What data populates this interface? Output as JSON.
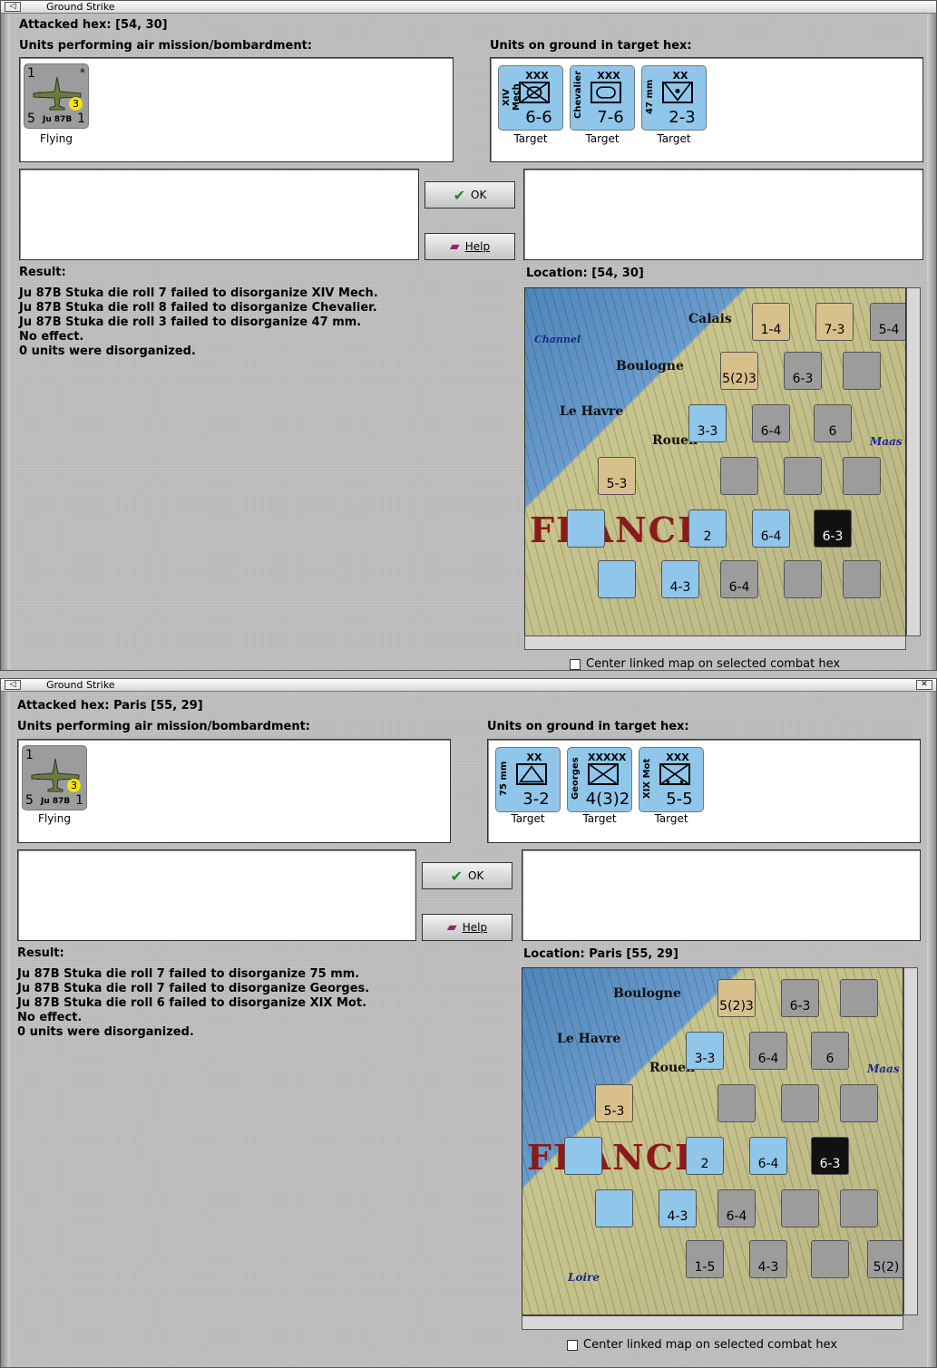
{
  "windows": [
    {
      "title": "Ground Strike",
      "attacked_hex": "Attacked hex:  [54, 30]",
      "air_units_label": "Units performing air mission/bombardment:",
      "ground_units_label": "Units on ground in target hex:",
      "air_unit": {
        "top_left": "1",
        "top_right": "*",
        "name": "Stuka",
        "model": "Ju 87B",
        "bottom_left": "5",
        "bottom_right": "1",
        "badge": "3",
        "status": "Flying"
      },
      "targets": [
        {
          "name": "XIV Mech",
          "size": "XXX",
          "strength": "6-6",
          "caption": "Target"
        },
        {
          "name": "Chevalier",
          "size": "XXX",
          "strength": "7-6",
          "caption": "Target"
        },
        {
          "name": "47 mm",
          "size": "XX",
          "strength": "2-3",
          "caption": "Target"
        }
      ],
      "ok_label": "OK",
      "help_label": "Help",
      "result_label": "Result:",
      "results": [
        "Ju 87B Stuka die roll 7 failed to disorganize XIV Mech.",
        "Ju 87B Stuka die roll 8 failed to disorganize Chevalier.",
        "Ju 87B Stuka die roll 3 failed to disorganize 47 mm.",
        "No effect.",
        "0 units were disorganized."
      ],
      "location": "Location:   [54, 30]",
      "center_label": "Center linked map on selected combat hex",
      "map_labels": [
        "Calais",
        "Boulogne",
        "Le Havre",
        "Rouen",
        "Channel",
        "Maas",
        "FRANCE"
      ]
    },
    {
      "title": "Ground Strike",
      "attacked_hex": "Attacked hex: Paris  [55, 29]",
      "air_units_label": "Units performing air mission/bombardment:",
      "ground_units_label": "Units on ground in target hex:",
      "air_unit": {
        "top_left": "1",
        "top_right": "",
        "name": "Stuka",
        "model": "Ju 87B",
        "bottom_left": "5",
        "bottom_right": "1",
        "badge": "3",
        "status": "Flying"
      },
      "targets": [
        {
          "name": "75 mm",
          "size": "XX",
          "strength": "3-2",
          "caption": "Target"
        },
        {
          "name": "Georges",
          "size": "XXXXX",
          "strength": "4(3)2",
          "caption": "Target"
        },
        {
          "name": "XIX Mot",
          "size": "XXX",
          "strength": "5-5",
          "caption": "Target"
        }
      ],
      "ok_label": "OK",
      "help_label": "Help",
      "result_label": "Result:",
      "results": [
        "Ju 87B Stuka die roll 7 failed to disorganize 75 mm.",
        "Ju 87B Stuka die roll 7 failed to disorganize Georges.",
        "Ju 87B Stuka die roll 6 failed to disorganize XIX Mot.",
        "No effect.",
        "0 units were disorganized."
      ],
      "location": "Location:  Paris  [55, 29]",
      "center_label": "Center linked map on selected combat hex",
      "map_labels": [
        "Boulogne",
        "Le Havre",
        "Rouen",
        "Loire",
        "Maas",
        "FRANCE"
      ]
    }
  ],
  "colors": {
    "friendly": "#8fc6ea",
    "enemy": "#9c9c9c",
    "tan": "#d8c08c",
    "france_text": "#8b1a1a"
  }
}
